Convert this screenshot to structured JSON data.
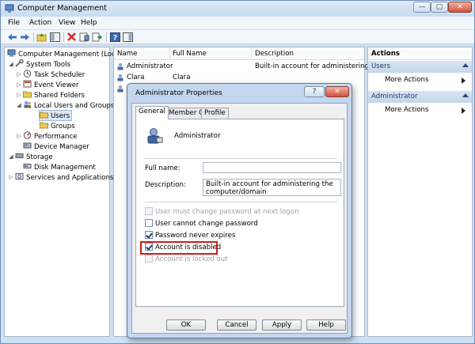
{
  "window": {
    "title": "Computer Management",
    "controls": {
      "minimize": "—",
      "maximize": "▢",
      "close": "✕"
    }
  },
  "menu": [
    "File",
    "Action",
    "View",
    "Help"
  ],
  "toolbar": {
    "icons": [
      "back-icon",
      "forward-icon",
      "up-icon",
      "show-hide-tree-icon",
      "delete-icon",
      "properties-icon",
      "export-icon",
      "help-icon",
      "show-hide-action-pane-icon"
    ]
  },
  "tree": [
    {
      "label": "Computer Management (Local"
    },
    {
      "label": "System Tools"
    },
    {
      "label": "Task Scheduler"
    },
    {
      "label": "Event Viewer"
    },
    {
      "label": "Shared Folders"
    },
    {
      "label": "Local Users and Groups"
    },
    {
      "label": "Users"
    },
    {
      "label": "Groups"
    },
    {
      "label": "Performance"
    },
    {
      "label": "Device Manager"
    },
    {
      "label": "Storage"
    },
    {
      "label": "Disk Management"
    },
    {
      "label": "Services and Applications"
    }
  ],
  "list": {
    "columns": [
      "Name",
      "Full Name",
      "Description"
    ],
    "rows": [
      {
        "name": "Administrator",
        "full_name": "",
        "description": "Built-in account for administering..."
      },
      {
        "name": "Clara",
        "full_name": "Clara",
        "description": ""
      },
      {
        "name": "",
        "full_name": "",
        "description": ""
      }
    ]
  },
  "actions": {
    "title": "Actions",
    "groups": [
      {
        "label": "Users",
        "item": "More Actions"
      },
      {
        "label": "Administrator",
        "item": "More Actions"
      }
    ]
  },
  "dialog": {
    "title": "Administrator Properties",
    "help_button": "?",
    "close_button": "✕",
    "tabs": [
      "General",
      "Member Of",
      "Profile"
    ],
    "active_tab": "General",
    "account_name": "Administrator",
    "full_name_label": "Full name:",
    "full_name_value": "",
    "description_label": "Description:",
    "description_value": "Built-in account for administering the computer/domain",
    "checkboxes": [
      {
        "label": "User must change password at next logon",
        "checked": false,
        "disabled": true
      },
      {
        "label": "User cannot change password",
        "checked": false,
        "disabled": false
      },
      {
        "label": "Password never expires",
        "checked": true,
        "disabled": false
      },
      {
        "label": "Account is disabled",
        "checked": true,
        "disabled": false
      },
      {
        "label": "Account is locked out",
        "checked": false,
        "disabled": true
      }
    ],
    "buttons": {
      "ok": "OK",
      "cancel": "Cancel",
      "apply": "Apply",
      "help": "Help"
    }
  },
  "colors": {
    "accent": "#c4d6ec",
    "highlight": "#cc1e1e",
    "selected_row": "#dde8f5"
  }
}
